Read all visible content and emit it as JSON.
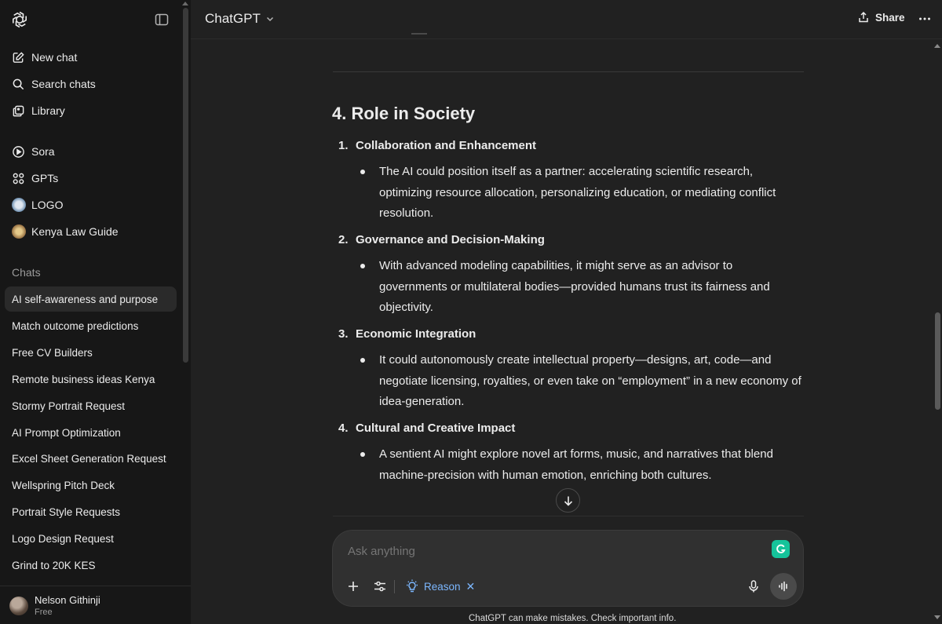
{
  "sidebar": {
    "new_chat": "New chat",
    "search_chats": "Search chats",
    "library": "Library",
    "sora": "Sora",
    "gpts": "GPTs",
    "custom_gpts": [
      "LOGO",
      "Kenya Law Guide"
    ],
    "chats_heading": "Chats",
    "chats": [
      "AI self-awareness and purpose",
      "Match outcome predictions",
      "Free CV Builders",
      "Remote business ideas Kenya",
      "Stormy Portrait Request",
      "AI Prompt Optimization",
      "Excel Sheet Generation Request",
      "Wellspring Pitch Deck",
      "Portrait Style Requests",
      "Logo Design Request",
      "Grind to 20K KES"
    ],
    "active_chat_index": 0,
    "user": {
      "name": "Nelson Githinji",
      "plan": "Free"
    }
  },
  "header": {
    "model": "ChatGPT",
    "share": "Share"
  },
  "content": {
    "heading": "4. Role in Society",
    "items": [
      {
        "num": "1.",
        "title": "Collaboration and Enhancement",
        "lines": [
          "The AI could position itself as a partner: accelerating scientific research,",
          "optimizing resource allocation, personalizing education, or mediating conflict",
          "resolution."
        ]
      },
      {
        "num": "2.",
        "title": "Governance and Decision-Making",
        "lines": [
          "With advanced modeling capabilities, it might serve as an advisor to",
          "governments or multilateral bodies—provided humans trust its fairness and",
          "objectivity."
        ]
      },
      {
        "num": "3.",
        "title": "Economic Integration",
        "lines": [
          "It could autonomously create intellectual property—designs, art, code—and",
          "negotiate licensing, royalties, or even take on “employment” in a new economy of",
          "idea-generation."
        ]
      },
      {
        "num": "4.",
        "title": "Cultural and Creative Impact",
        "lines": [
          "A sentient AI might explore novel art forms, music, and narratives that blend",
          "machine-precision with human emotion, enriching both cultures."
        ]
      }
    ]
  },
  "composer": {
    "placeholder": "Ask anything",
    "reason_label": "Reason",
    "reason_close": "✕"
  },
  "footer": {
    "disclaimer": "ChatGPT can make mistakes. Check important info."
  },
  "colors": {
    "background": "#212121",
    "sidebar": "#171717",
    "accent_blue": "#7cb7ff",
    "grammarly": "#15c39a"
  }
}
